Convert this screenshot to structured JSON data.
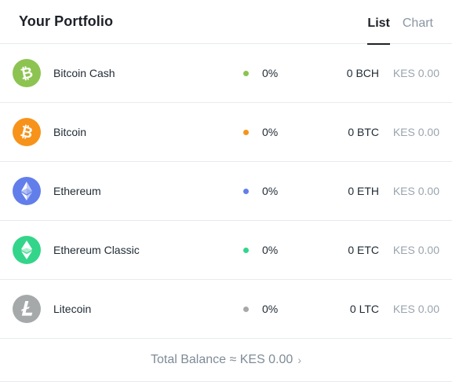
{
  "header": {
    "title": "Your Portfolio",
    "tabs": [
      {
        "label": "List",
        "active": true
      },
      {
        "label": "Chart",
        "active": false
      }
    ]
  },
  "assets": [
    {
      "name": "Bitcoin Cash",
      "icon": "bitcoin-cash-icon",
      "color": "#8dc351",
      "percent": "0%",
      "amount": "0 BCH",
      "fiat": "KES 0.00"
    },
    {
      "name": "Bitcoin",
      "icon": "bitcoin-icon",
      "color": "#f7931a",
      "percent": "0%",
      "amount": "0 BTC",
      "fiat": "KES 0.00"
    },
    {
      "name": "Ethereum",
      "icon": "ethereum-icon",
      "color": "#627eea",
      "percent": "0%",
      "amount": "0 ETH",
      "fiat": "KES 0.00"
    },
    {
      "name": "Ethereum Classic",
      "icon": "ethereum-classic-icon",
      "color": "#33d58b",
      "percent": "0%",
      "amount": "0 ETC",
      "fiat": "KES 0.00"
    },
    {
      "name": "Litecoin",
      "icon": "litecoin-icon",
      "color": "#a6a9aa",
      "percent": "0%",
      "amount": "0 LTC",
      "fiat": "KES 0.00"
    }
  ],
  "footer": {
    "total_label": "Total Balance ≈ KES 0.00",
    "chevron": "›"
  }
}
